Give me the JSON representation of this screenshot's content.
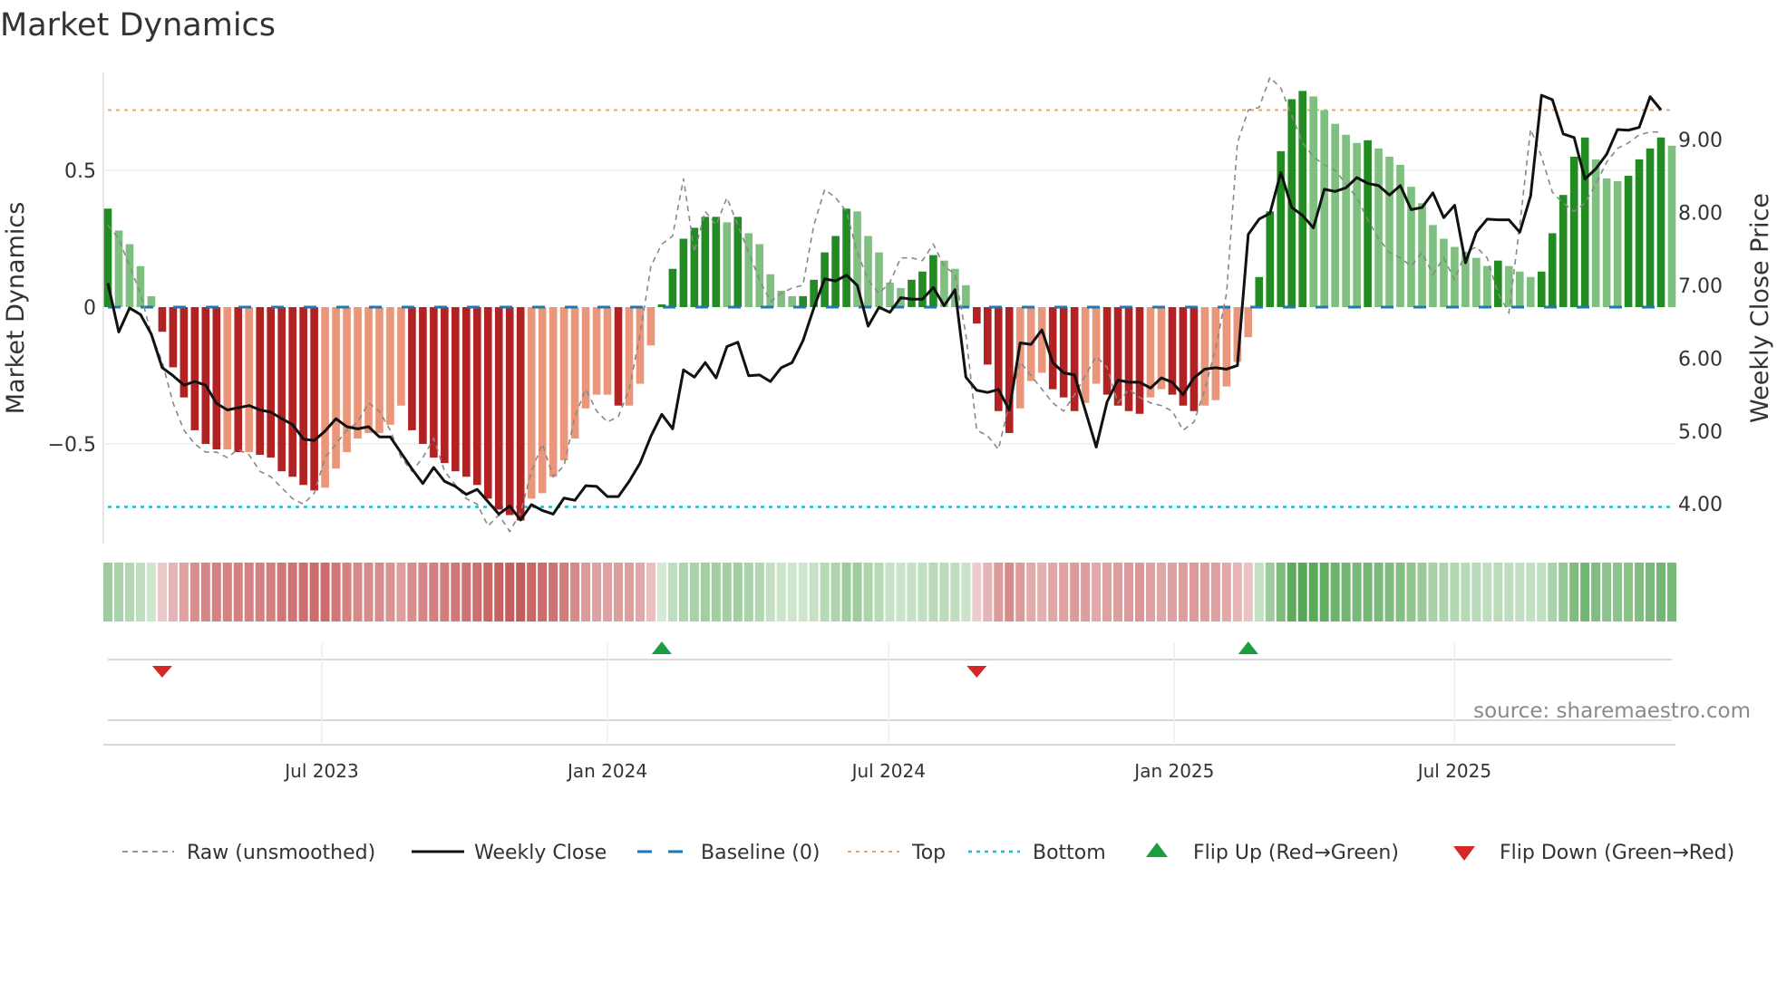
{
  "chart_data": {
    "type": "bar",
    "title": "Market Dynamics",
    "ylabel": "Market Dynamics",
    "y2label": "Weekly Close Price",
    "ylim": [
      -0.85,
      0.85
    ],
    "y2lim": [
      3.6,
      9.9
    ],
    "yticks": [
      {
        "v": 0.5,
        "label": "0.5"
      },
      {
        "v": 0,
        "label": "0"
      },
      {
        "v": -0.5,
        "label": "−0.5"
      }
    ],
    "y2ticks": [
      {
        "v": 9,
        "label": "9.00"
      },
      {
        "v": 8,
        "label": "8.00"
      },
      {
        "v": 7,
        "label": "7.00"
      },
      {
        "v": 6,
        "label": "6.00"
      },
      {
        "v": 5,
        "label": "5.00"
      },
      {
        "v": 4,
        "label": "4.00"
      }
    ],
    "xticks": [
      {
        "week": 19.7,
        "label": "Jul 2023"
      },
      {
        "week": 46,
        "label": "Jan 2024"
      },
      {
        "week": 71.9,
        "label": "Jul 2024"
      },
      {
        "week": 98.2,
        "label": "Jan 2025"
      },
      {
        "week": 124,
        "label": "Jul 2025"
      }
    ],
    "top_level": 0.72,
    "bottom_level": -0.73,
    "baseline": 0,
    "colors": {
      "up_pos": "#228b22",
      "down_pos": "#7fbf7f",
      "down_neg": "#b22222",
      "up_neg": "#e9967a",
      "top": "#f4a460",
      "bottom": "#17becf",
      "baseline": "#1f77b4",
      "raw": "#888888",
      "close": "#111111",
      "flip_up": "#1a9e3f",
      "flip_down": "#d62728"
    },
    "smoothed": [
      0.36,
      0.28,
      0.23,
      0.15,
      0.04,
      -0.09,
      -0.22,
      -0.33,
      -0.45,
      -0.5,
      -0.52,
      -0.52,
      -0.53,
      -0.53,
      -0.54,
      -0.55,
      -0.6,
      -0.62,
      -0.65,
      -0.67,
      -0.66,
      -0.59,
      -0.53,
      -0.48,
      -0.46,
      -0.46,
      -0.43,
      -0.36,
      -0.45,
      -0.5,
      -0.55,
      -0.57,
      -0.6,
      -0.62,
      -0.65,
      -0.7,
      -0.74,
      -0.76,
      -0.78,
      -0.7,
      -0.68,
      -0.62,
      -0.56,
      -0.48,
      -0.37,
      -0.32,
      -0.32,
      -0.36,
      -0.36,
      -0.28,
      -0.14,
      0.01,
      0.14,
      0.25,
      0.29,
      0.33,
      0.33,
      0.31,
      0.33,
      0.27,
      0.23,
      0.12,
      0.06,
      0.04,
      0.04,
      0.1,
      0.2,
      0.26,
      0.36,
      0.35,
      0.26,
      0.2,
      0.09,
      0.07,
      0.1,
      0.13,
      0.19,
      0.17,
      0.14,
      0.08,
      -0.06,
      -0.21,
      -0.38,
      -0.46,
      -0.37,
      -0.27,
      -0.24,
      -0.3,
      -0.33,
      -0.38,
      -0.35,
      -0.28,
      -0.32,
      -0.36,
      -0.38,
      -0.39,
      -0.33,
      -0.3,
      -0.32,
      -0.36,
      -0.38,
      -0.36,
      -0.34,
      -0.29,
      -0.2,
      -0.11,
      0.11,
      0.35,
      0.57,
      0.76,
      0.79,
      0.77,
      0.72,
      0.67,
      0.63,
      0.6,
      0.61,
      0.58,
      0.55,
      0.52,
      0.44,
      0.38,
      0.3,
      0.25,
      0.22,
      0.2,
      0.18,
      0.15,
      0.17,
      0.15,
      0.13,
      0.11,
      0.13,
      0.27,
      0.41,
      0.55,
      0.62,
      0.54,
      0.47,
      0.46,
      0.48,
      0.54,
      0.58,
      0.62,
      0.59
    ],
    "raw": [
      0.3,
      0.25,
      0.15,
      0.05,
      -0.1,
      -0.2,
      -0.35,
      -0.45,
      -0.5,
      -0.53,
      -0.53,
      -0.55,
      -0.52,
      -0.54,
      -0.6,
      -0.62,
      -0.66,
      -0.7,
      -0.72,
      -0.68,
      -0.55,
      -0.5,
      -0.45,
      -0.42,
      -0.35,
      -0.38,
      -0.45,
      -0.55,
      -0.6,
      -0.55,
      -0.48,
      -0.6,
      -0.65,
      -0.7,
      -0.72,
      -0.8,
      -0.76,
      -0.82,
      -0.75,
      -0.6,
      -0.5,
      -0.62,
      -0.58,
      -0.4,
      -0.3,
      -0.38,
      -0.42,
      -0.4,
      -0.3,
      -0.1,
      0.15,
      0.23,
      0.26,
      0.47,
      0.2,
      0.35,
      0.3,
      0.4,
      0.3,
      0.2,
      0.1,
      0.02,
      0.05,
      0.07,
      0.08,
      0.3,
      0.43,
      0.4,
      0.35,
      0.2,
      0.1,
      0.05,
      0.09,
      0.18,
      0.18,
      0.17,
      0.23,
      0.15,
      0.12,
      -0.1,
      -0.45,
      -0.47,
      -0.52,
      -0.35,
      -0.2,
      -0.25,
      -0.3,
      -0.35,
      -0.38,
      -0.32,
      -0.25,
      -0.18,
      -0.22,
      -0.35,
      -0.3,
      -0.33,
      -0.35,
      -0.36,
      -0.38,
      -0.45,
      -0.42,
      -0.3,
      -0.15,
      0.05,
      0.6,
      0.72,
      0.73,
      0.84,
      0.8,
      0.7,
      0.6,
      0.55,
      0.52,
      0.5,
      0.45,
      0.4,
      0.32,
      0.25,
      0.2,
      0.18,
      0.15,
      0.2,
      0.12,
      0.18,
      0.1,
      0.2,
      0.22,
      0.18,
      0.05,
      -0.02,
      0.3,
      0.65,
      0.55,
      0.42,
      0.38,
      0.35,
      0.38,
      0.45,
      0.53,
      0.58,
      0.6,
      0.63,
      0.64,
      0.64
    ],
    "weekly_close": [
      7.03,
      6.36,
      6.69,
      6.6,
      6.33,
      5.87,
      5.76,
      5.63,
      5.68,
      5.63,
      5.38,
      5.29,
      5.32,
      5.35,
      5.29,
      5.26,
      5.17,
      5.09,
      4.89,
      4.87,
      5.0,
      5.17,
      5.06,
      5.03,
      5.06,
      4.92,
      4.92,
      4.7,
      4.48,
      4.28,
      4.5,
      4.31,
      4.24,
      4.13,
      4.2,
      4.03,
      3.86,
      3.97,
      3.78,
      3.99,
      3.91,
      3.86,
      4.08,
      4.05,
      4.25,
      4.24,
      4.1,
      4.1,
      4.31,
      4.56,
      4.93,
      5.23,
      5.03,
      5.84,
      5.74,
      5.94,
      5.73,
      6.16,
      6.22,
      5.76,
      5.77,
      5.68,
      5.87,
      5.94,
      6.24,
      6.69,
      7.09,
      7.06,
      7.14,
      7.0,
      6.44,
      6.7,
      6.63,
      6.83,
      6.81,
      6.81,
      6.97,
      6.72,
      6.94,
      5.74,
      5.56,
      5.53,
      5.57,
      5.29,
      6.21,
      6.19,
      6.39,
      5.94,
      5.8,
      5.77,
      5.28,
      4.78,
      5.4,
      5.7,
      5.67,
      5.67,
      5.59,
      5.73,
      5.67,
      5.5,
      5.73,
      5.85,
      5.87,
      5.85,
      5.9,
      7.7,
      7.91,
      7.99,
      8.55,
      8.07,
      7.96,
      7.79,
      8.32,
      8.29,
      8.34,
      8.48,
      8.4,
      8.37,
      8.24,
      8.37,
      8.04,
      8.07,
      8.27,
      7.93,
      8.1,
      7.31,
      7.73,
      7.91,
      7.9,
      7.9,
      7.73,
      8.23,
      9.61,
      9.55,
      9.08,
      9.03,
      8.46,
      8.6,
      8.8,
      9.14,
      9.13,
      9.17,
      9.59,
      9.41
    ],
    "flips": [
      {
        "week": 5,
        "dir": "down"
      },
      {
        "week": 51,
        "dir": "up"
      },
      {
        "week": 80,
        "dir": "down"
      },
      {
        "week": 105,
        "dir": "up"
      }
    ],
    "legend": {
      "position": "bottom",
      "raw": "Raw (unsmoothed)",
      "close": "Weekly Close",
      "baseline": "Baseline (0)",
      "top": "Top",
      "bottom": "Bottom",
      "flip_up": "Flip Up (Red→Green)",
      "flip_down": "Flip Down (Green→Red)"
    },
    "source": "source: sharemaestro.com"
  }
}
